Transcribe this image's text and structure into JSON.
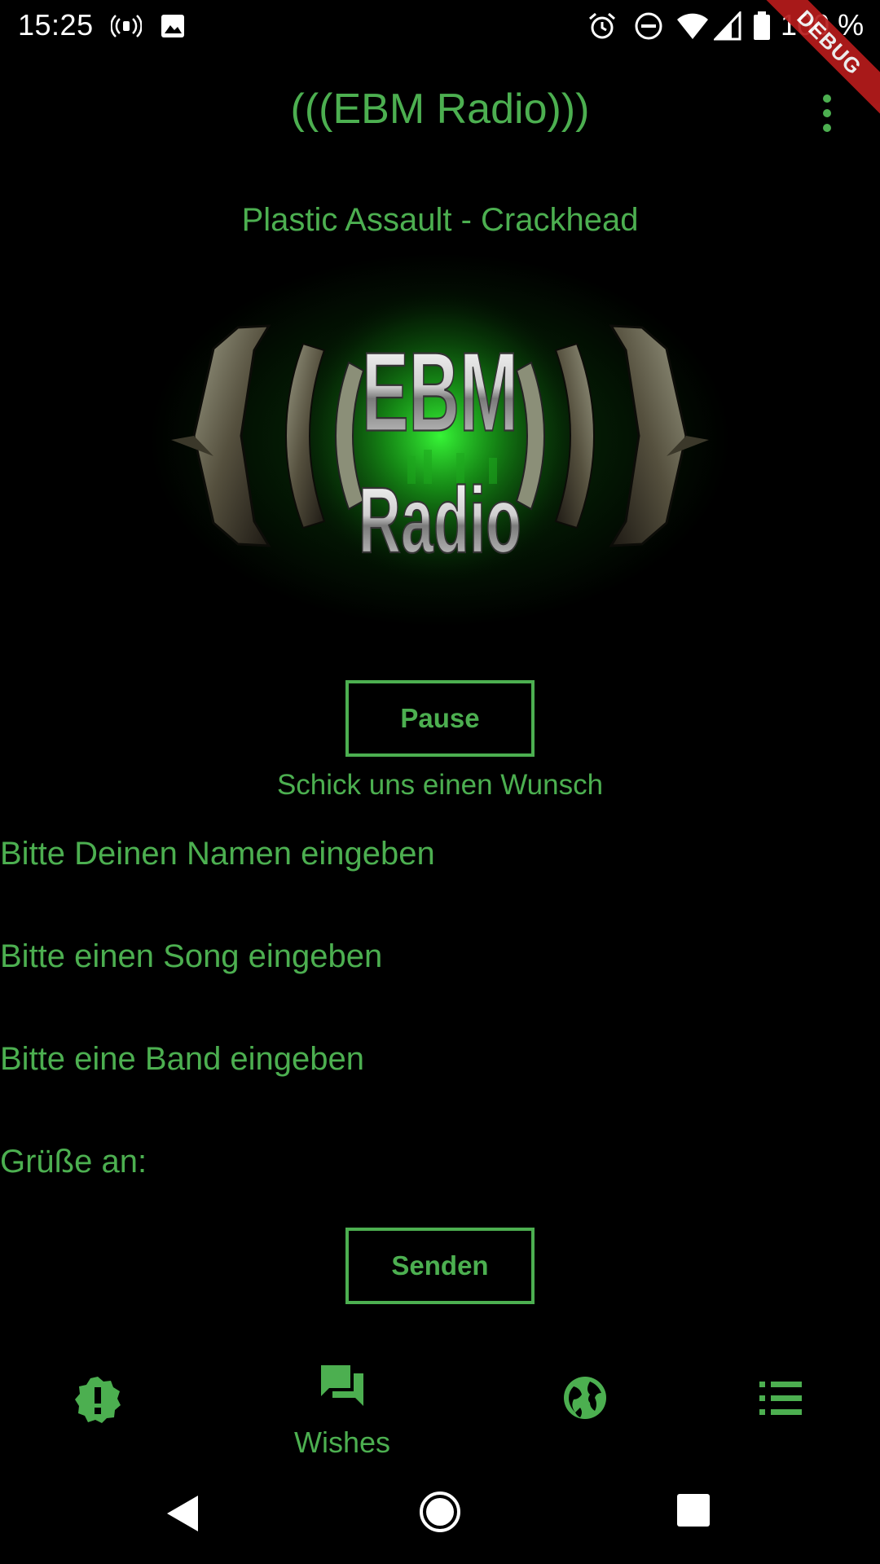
{
  "status_bar": {
    "time": "15:25",
    "battery": "100 %",
    "icons": [
      "nfc-signal-icon",
      "image-icon",
      "alarm-icon",
      "do-not-disturb-icon",
      "wifi-icon",
      "cell-signal-icon",
      "battery-icon"
    ]
  },
  "debug_banner": "DEBUG",
  "app_bar": {
    "title": "(((EBM Radio)))",
    "menu_icon": "more-vert-icon"
  },
  "player": {
    "now_playing": "Plastic Assault - Crackhead",
    "logo_text_top": "EBM",
    "logo_text_bottom": "Radio",
    "pause_label": "Pause"
  },
  "wish_form": {
    "heading": "Schick uns einen Wunsch",
    "name_placeholder": "Bitte Deinen Namen eingeben",
    "song_placeholder": "Bitte einen Song eingeben",
    "band_placeholder": "Bitte eine Band eingeben",
    "greetings_placeholder": "Grüße an:",
    "send_label": "Senden"
  },
  "bottom_nav": {
    "items": [
      {
        "icon": "alert-badge-icon",
        "label": ""
      },
      {
        "icon": "forum-icon",
        "label": "Wishes",
        "active": true
      },
      {
        "icon": "globe-icon",
        "label": ""
      },
      {
        "icon": "list-icon",
        "label": ""
      }
    ]
  },
  "colors": {
    "accent": "#4caf50",
    "background": "#000000",
    "debug": "#b71c1c"
  }
}
